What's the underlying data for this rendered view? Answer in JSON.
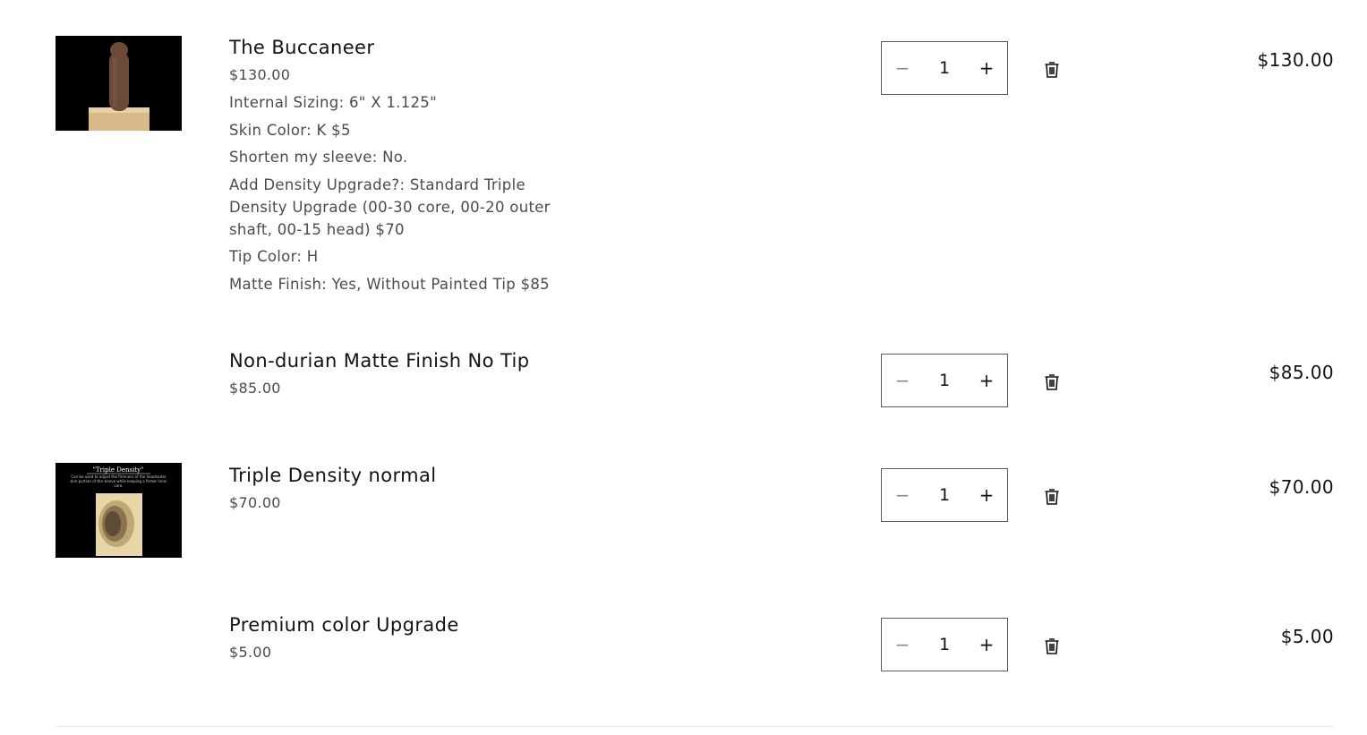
{
  "items": [
    {
      "name": "The Buccaneer",
      "unit_price": "$130.00",
      "options": [
        "Internal Sizing: 6\" X 1.125\"",
        "Skin Color: K $5",
        "Shorten my sleeve: No.",
        "Add Density Upgrade?: Standard Triple Density Upgrade (00-30 core, 00-20 outer shaft, 00-15 head) $70",
        "Tip Color: H",
        "Matte Finish: Yes, Without Painted Tip $85"
      ],
      "quantity": "1",
      "total": "$130.00"
    },
    {
      "name": "Non-durian Matte Finish No Tip",
      "unit_price": "$85.00",
      "quantity": "1",
      "total": "$85.00"
    },
    {
      "name": "Triple Density normal",
      "unit_price": "$70.00",
      "image_text": {
        "title": "\"Triple Density\"",
        "caption": "Can be used to adjust the firmness of the head/outer skin portion of the sleeve while keeping a firmer inner core."
      },
      "quantity": "1",
      "total": "$70.00"
    },
    {
      "name": "Premium color Upgrade",
      "unit_price": "$5.00",
      "quantity": "1",
      "total": "$5.00"
    }
  ],
  "icons": {
    "minus": "minus-icon",
    "plus": "plus-icon",
    "remove": "trash-icon"
  },
  "glyphs": {
    "minus": "−",
    "plus": "+"
  }
}
